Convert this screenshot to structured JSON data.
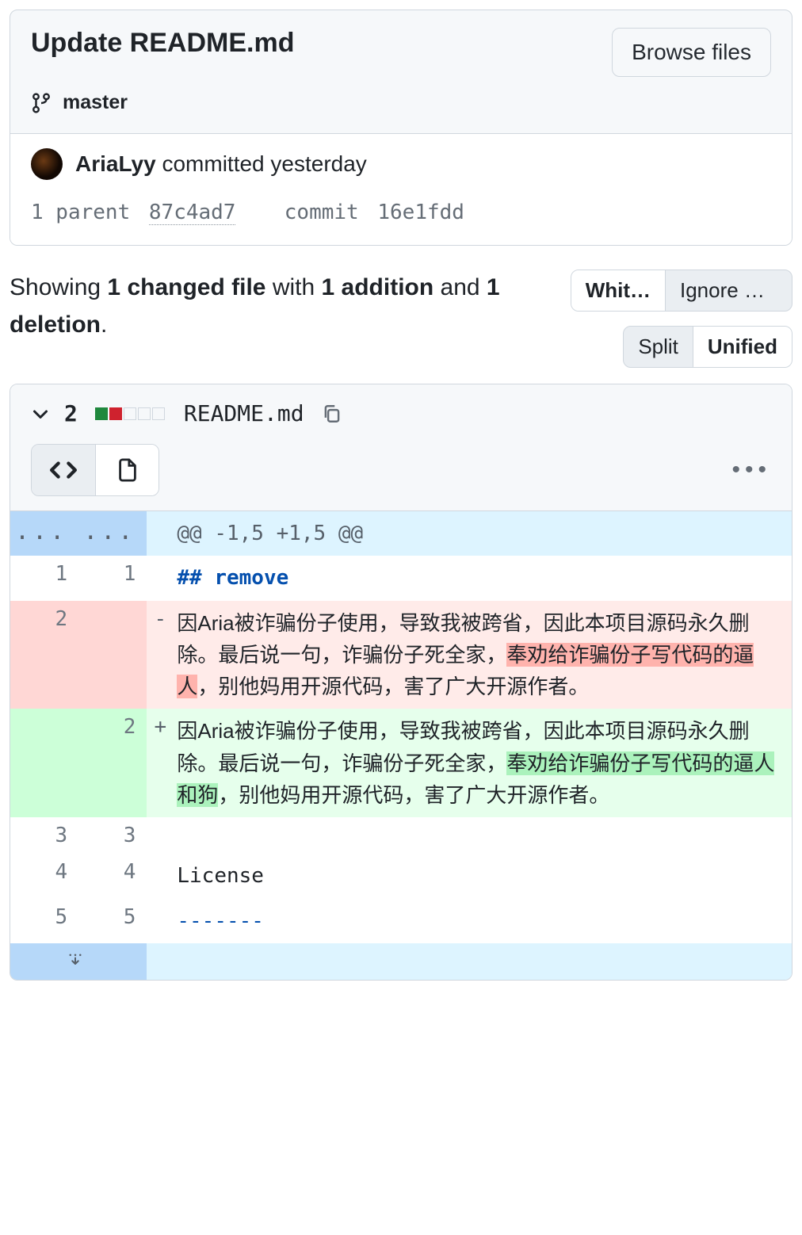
{
  "commit": {
    "title": "Update README.md",
    "browse_button": "Browse files",
    "branch": "master",
    "author": "AriaLyy",
    "committed_text": "committed yesterday",
    "parents_label": "1 parent",
    "parent_sha": "87c4ad7",
    "commit_label": "commit",
    "commit_sha": "16e1fdd"
  },
  "summary": {
    "prefix": "Showing ",
    "changed_files": "1 changed file",
    "with": " with ",
    "additions": "1 addition",
    "and": " and ",
    "deletions": "1 deletion",
    "suffix": "."
  },
  "toggles": {
    "whitespace_on": "Whit…",
    "whitespace_off": "Ignore w…",
    "split": "Split",
    "unified": "Unified"
  },
  "file": {
    "change_count": "2",
    "name": "README.md",
    "diffstat": [
      "add",
      "del",
      "empty",
      "empty",
      "empty"
    ]
  },
  "diff": {
    "hunk_header": "@@ -1,5 +1,5 @@",
    "rows": [
      {
        "type": "ctx",
        "old": "1",
        "new": "1",
        "mark": "",
        "text": "## remove",
        "render": "md_h"
      },
      {
        "type": "del",
        "old": "2",
        "new": "",
        "mark": "-",
        "pre": "因Aria被诈骗份子使用，导致我被跨省，因此本项目源码永久删除。最后说一句，诈骗份子死全家，",
        "hl": "奉劝给诈骗份子写代码的逼人",
        "post": "，别他妈用开源代码，害了广大开源作者。"
      },
      {
        "type": "add",
        "old": "",
        "new": "2",
        "mark": "+",
        "pre": "因Aria被诈骗份子使用，导致我被跨省，因此本项目源码永久删除。最后说一句，诈骗份子死全家，",
        "hl": "奉劝给诈骗份子写代码的逼人和狗",
        "post": "，别他妈用开源代码，害了广大开源作者。"
      },
      {
        "type": "ctx",
        "old": "3",
        "new": "3",
        "mark": "",
        "text": ""
      },
      {
        "type": "ctx",
        "old": "4",
        "new": "4",
        "mark": "",
        "text": "License"
      },
      {
        "type": "ctx",
        "old": "5",
        "new": "5",
        "mark": "",
        "text": "-------",
        "render": "md_rule"
      }
    ],
    "expand_glyph": "↓"
  }
}
